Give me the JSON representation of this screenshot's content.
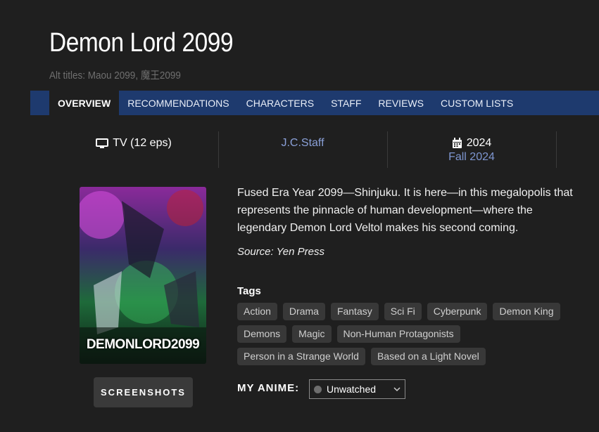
{
  "anime": {
    "title": "Demon Lord 2099",
    "alt_titles": "Alt titles: Maou 2099, 魔王2099"
  },
  "tabs": [
    {
      "label": "OVERVIEW",
      "active": true
    },
    {
      "label": "RECOMMENDATIONS"
    },
    {
      "label": "CHARACTERS"
    },
    {
      "label": "STAFF"
    },
    {
      "label": "REVIEWS"
    },
    {
      "label": "CUSTOM LISTS"
    }
  ],
  "info": {
    "format": "TV (12 eps)",
    "format_icon": "monitor-icon",
    "studio": "J.C.Staff",
    "year": "2024",
    "year_icon": "calendar-icon",
    "season": "Fall 2024"
  },
  "poster": {
    "logo_text": "DEMONLORD2099"
  },
  "screenshots_label": "SCREENSHOTS",
  "synopsis": "Fused Era Year 2099—Shinjuku. It is here—in this megalopolis that represents the pinnacle of human development—where the legendary Demon Lord Veltol makes his second coming.",
  "source": "Source: Yen Press",
  "tags_label": "Tags",
  "tags": [
    [
      "Action",
      "Drama",
      "Fantasy",
      "Sci Fi",
      "Cyberpunk",
      "Demon King"
    ],
    [
      "Demons",
      "Magic",
      "Non-Human Protagonists"
    ],
    [
      "Person in a Strange World",
      "Based on a Light Novel"
    ]
  ],
  "my_anime": {
    "label": "MY ANIME:",
    "status": "Unwatched"
  },
  "colors": {
    "background": "#1f1f1f",
    "tab_bar": "#1e3a6e",
    "link": "#8aa0d8",
    "tag_bg": "#383838"
  }
}
